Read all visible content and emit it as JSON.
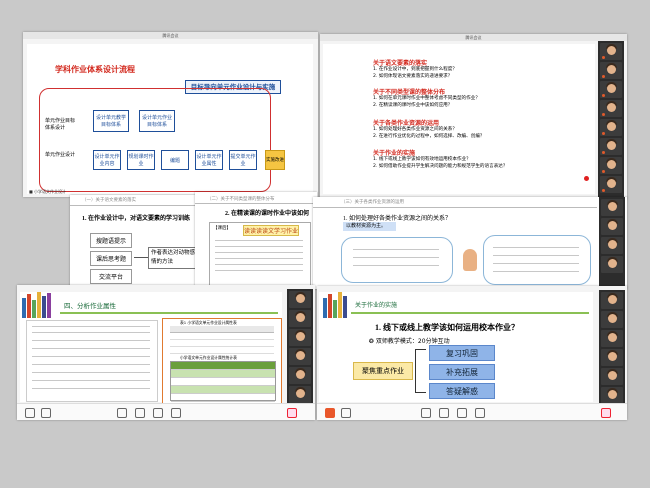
{
  "screens": {
    "top_left": {
      "window_title": "腾讯会议",
      "slide_title": "学科作业体系设计流程",
      "sidebar_label_1": "单元作业目标体系设计",
      "sidebar_label_2": "单元作业设计",
      "banner": "目标导向单元作业设计与实施",
      "boxes_row1": [
        "设计单元教学目标体系",
        "设计单元作业目标体系"
      ],
      "boxes_row2": [
        "设计单元作业内容",
        "规划课时作业",
        "编题",
        "设计单元作业属性",
        "提交单元作业"
      ],
      "side_tag": "实施改进",
      "bottom_text": "■ 小学语文作业设计"
    },
    "top_right": {
      "window_title": "腾讯会议",
      "section1_title": "关于语文要素的落实",
      "section1_items": [
        "1. 在作业设计中，到底把握到什么程度？",
        "2. 如何体现语文要素落实的递进要求？"
      ],
      "section2_title": "关于不同类型课的整体分布",
      "section2_items": [
        "1. 如何在单元课时作业中整体考虑不同类型的作业？",
        "2. 在精读课的课时作业中该如何应用？"
      ],
      "section3_title": "关于各类作业资源的运用",
      "section3_items": [
        "1. 如何处理好各类作业资源之间的关系？",
        "2. 在进行作业优化的过程中，如何选择、改编、创编？"
      ],
      "section4_title": "关于作业的实施",
      "section4_items": [
        "1. 线下或线上教学该如何有效地运用校本作业？",
        "2. 如何借助作业提升学生解决问题的能力和规范学生的语言表达？"
      ]
    },
    "mid_left": {
      "header_strip": "（一）关于语文要素的落实",
      "heading": "1. 在作业设计中，对语文要素的学习训练",
      "pills": [
        "搜题语提示",
        "课后思考题",
        "交流平台"
      ],
      "result_box": "作者表达对动物感情的方法"
    },
    "mid_center": {
      "header_strip": "（二）关于不同类型课的整体分布",
      "heading": "2. 在精读课的课时作业中该如何",
      "subtitle": "读读读读文学习作业",
      "label": "【课后】"
    },
    "mid_right": {
      "header_strip": "（三）关于各类作业资源的运用",
      "heading": "1. 如何处理好各类作业资源之间的关系？",
      "highlight": "以教材资源为主。"
    },
    "bottom_left": {
      "header": "四、分析作业属性",
      "table_title": "表1 小学语文单元作业设计属性表",
      "table2_title": "小学语文单元作业设计属性统计表"
    },
    "bottom_right": {
      "header": "关于作业的实施",
      "question": "1. 线下或线上教学该如何运用校本作业？",
      "mode": "❂ 双师教学模式：20分钟互动",
      "focus": "聚焦重点作业",
      "buttons": [
        "复习巩固",
        "补充拓展",
        "答疑解惑"
      ]
    }
  },
  "colors": {
    "accent_red": "#d32a1f",
    "button_blue": "#8fb4e8",
    "focus_yellow": "#fbe9a6",
    "header_green": "#6a9f3c"
  }
}
